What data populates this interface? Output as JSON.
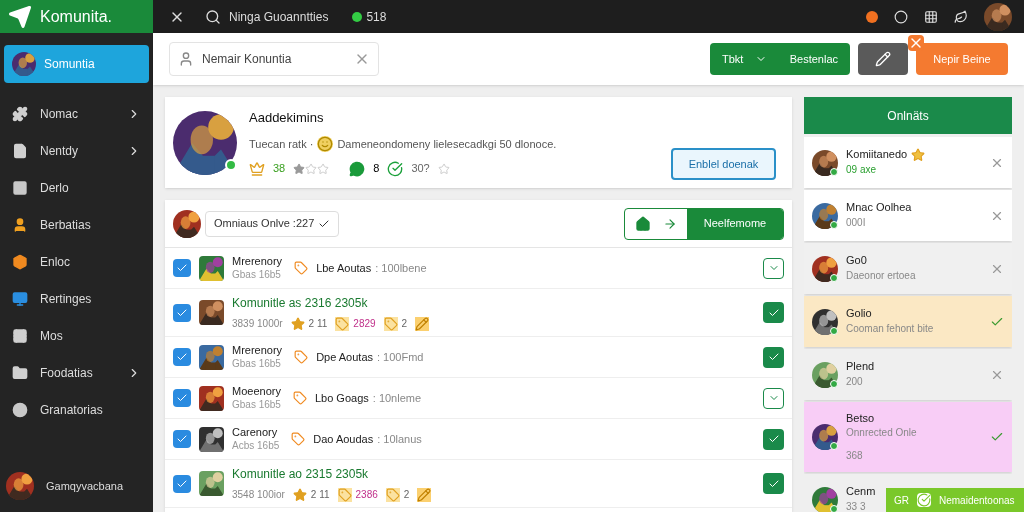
{
  "topbar": {
    "logo": "Komunita.",
    "search_text": "Ninga Guoanntties",
    "online_count": "518"
  },
  "sidebar": {
    "active": {
      "label": "Somuntia",
      "selected": true
    },
    "items": [
      {
        "label": "Nomac",
        "has_children": true,
        "color": "#d0d0d0",
        "selected": false
      },
      {
        "label": "Nentdy",
        "has_children": true,
        "color": "#d0d0d0",
        "selected": false
      },
      {
        "label": "Derlo",
        "has_children": false,
        "color": "#c8c8c8",
        "selected": false
      },
      {
        "label": "Berbatias",
        "has_children": false,
        "color": "#f0a020",
        "selected": false
      },
      {
        "label": "Enloc",
        "has_children": false,
        "color": "#f08a20",
        "selected": false
      },
      {
        "label": "Rertinges",
        "has_children": false,
        "color": "#2a8ee0",
        "selected": false
      },
      {
        "label": "Mos",
        "has_children": false,
        "color": "#d0d0d0",
        "selected": false
      },
      {
        "label": "Foodatias",
        "has_children": true,
        "color": "#d0d0d0",
        "selected": false
      },
      {
        "label": "Granatorias",
        "has_children": false,
        "color": "#c8c8c8",
        "selected": false
      }
    ],
    "user": "Gamqyvacbana"
  },
  "toolbar": {
    "search_value": "Nemair Konuntia",
    "split_button": {
      "left": "Tbkt",
      "right": "Bestenlac"
    },
    "primary_button": "Nepir Beine"
  },
  "profile": {
    "name": "Aaddekimins",
    "online": true,
    "tagline": "Tuecan ratk · ",
    "description": "Dameneondomeny lielesecadkgi 50 dlonoce.",
    "level": "38",
    "stars": 1,
    "messages": "8",
    "points": "30?",
    "button": "Enblel doenak"
  },
  "filter": {
    "dropdown": "Omniaus Onlve :227",
    "button": "Neelfemome"
  },
  "rows": [
    {
      "kind": "simple",
      "checked": true,
      "title": "Mrerenory",
      "subtitle": "Gbas 16b5",
      "tag": "Lbe Aoutas",
      "detail": ": 100lbene",
      "action_filled": false
    },
    {
      "kind": "featured",
      "checked": true,
      "title": "Komunitle as 2316 2305k",
      "subtitle": "3839 1000r",
      "stats": [
        {
          "kind": "star",
          "text": "2 11"
        },
        {
          "kind": "tag",
          "text": "2829"
        },
        {
          "kind": "tag",
          "text": "2"
        },
        {
          "kind": "edit"
        }
      ],
      "action_filled": true
    },
    {
      "kind": "simple",
      "checked": true,
      "title": "Mrerenory",
      "subtitle": "Gbas 16b5",
      "tag": "Dpe Aoutas",
      "detail": ": 100Fmd",
      "action_filled": true
    },
    {
      "kind": "simple",
      "checked": true,
      "title": "Moeenory",
      "subtitle": "Gbas 16b5",
      "tag": "Lbo Goags",
      "detail": ": 10nleme",
      "action_filled": false
    },
    {
      "kind": "simple",
      "checked": true,
      "title": "Carenory",
      "subtitle": "Acbs 16b5",
      "tag": "Dao Aoudas",
      "detail": ": 10lanus",
      "action_filled": true
    },
    {
      "kind": "featured",
      "checked": true,
      "title": "Komunitle ao 2315 2305k",
      "subtitle": "3548 100ior",
      "stats": [
        {
          "kind": "star",
          "text": "2 11"
        },
        {
          "kind": "tag",
          "text": "2386"
        },
        {
          "kind": "tag",
          "text": "2"
        },
        {
          "kind": "edit"
        }
      ],
      "action_filled": true
    }
  ],
  "friends": {
    "title": "Onlnäts",
    "items": [
      {
        "name": "Komiitanedo",
        "sub": "09 axe",
        "sub_highlight": true,
        "badge": true,
        "kind": "dismiss",
        "color": "#ffffff"
      },
      {
        "name": "Mnac Oolhea",
        "sub": "000I",
        "sub_highlight": false,
        "badge": false,
        "kind": "dismiss",
        "color": "#ffffff"
      },
      {
        "name": "Go0",
        "sub": "Daeonor ertoea",
        "sub_highlight": false,
        "badge": false,
        "kind": "dismiss",
        "color": "#f0f0f0"
      },
      {
        "name": "Golio",
        "sub": "Cooman fehont bite",
        "sub_highlight": false,
        "badge": false,
        "kind": "accept",
        "color": "#fbe8c4"
      },
      {
        "name": "Plend",
        "sub": "200",
        "sub_highlight": false,
        "badge": false,
        "kind": "dismiss",
        "color": "#efefef"
      },
      {
        "name": "Betso",
        "sub": "Onnrected Onle",
        "extra": "368",
        "sub_highlight": false,
        "badge": false,
        "kind": "accept",
        "color": "#f8cdf6"
      },
      {
        "name": "Cenm",
        "sub": "33 3",
        "sub_highlight": false,
        "badge": false,
        "kind": "none",
        "color": "#efefef"
      }
    ]
  },
  "toast": {
    "prefix": "GR",
    "text": "Nemaidentoonas"
  }
}
